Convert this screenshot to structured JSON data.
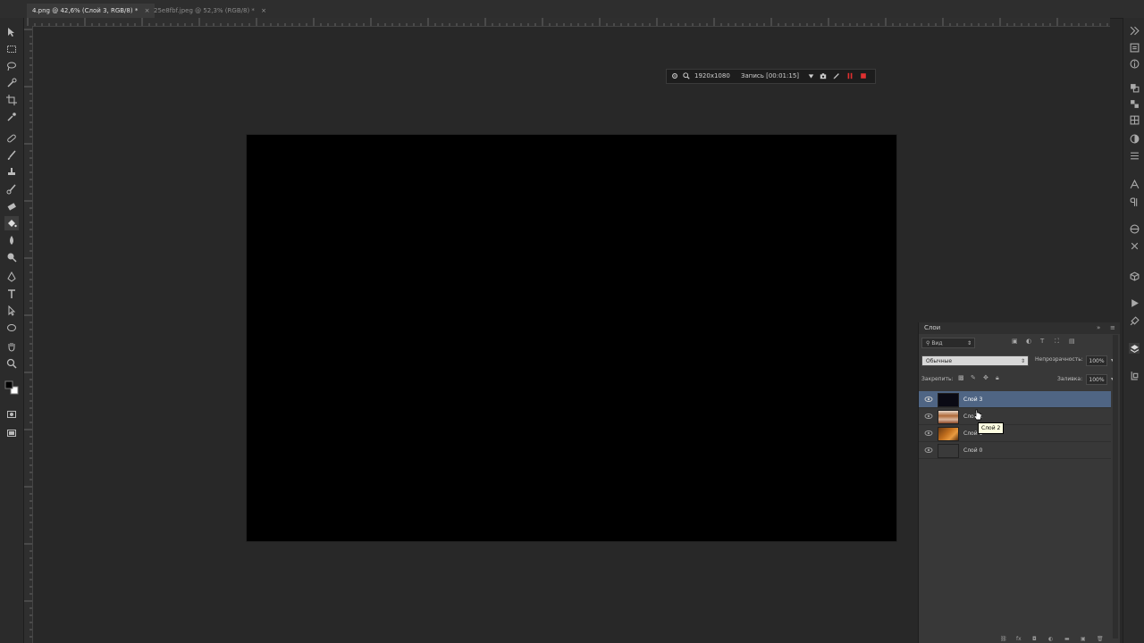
{
  "tabs": [
    {
      "label": "4.png @ 42,6% (Слой 3, RGB/8) *",
      "close": "×",
      "active": true
    },
    {
      "label": "25e8fbf.jpeg @ 52,3% (RGB/8) *",
      "close": "×",
      "active": false
    }
  ],
  "recorder": {
    "resolution": "1920x1080",
    "recording": "Запись [00:01:15]"
  },
  "layers_panel": {
    "title": "Слои",
    "collapse": "»",
    "menu": "≡",
    "filter_kind": "Вид",
    "blend_mode": "Обычные",
    "opacity_label": "Непрозрачность:",
    "opacity_value": "100%",
    "lock_label": "Закрепить:",
    "fill_label": "Заливка:",
    "fill_value": "100%",
    "layers": [
      {
        "name": "Слой 3",
        "selected": true,
        "thumb": "#0a0a14"
      },
      {
        "name": "Слой 2",
        "selected": false,
        "thumb": "#b06a3a"
      },
      {
        "name": "Слой 1",
        "selected": false,
        "thumb": "#c4701e"
      },
      {
        "name": "Слой 0",
        "selected": false,
        "thumb": "#3a3a3a"
      }
    ],
    "tooltip": "Слой 2"
  },
  "colors": {
    "canvas": "#000000",
    "selected_layer": "#4f6584",
    "record_accent": "#e03030"
  }
}
